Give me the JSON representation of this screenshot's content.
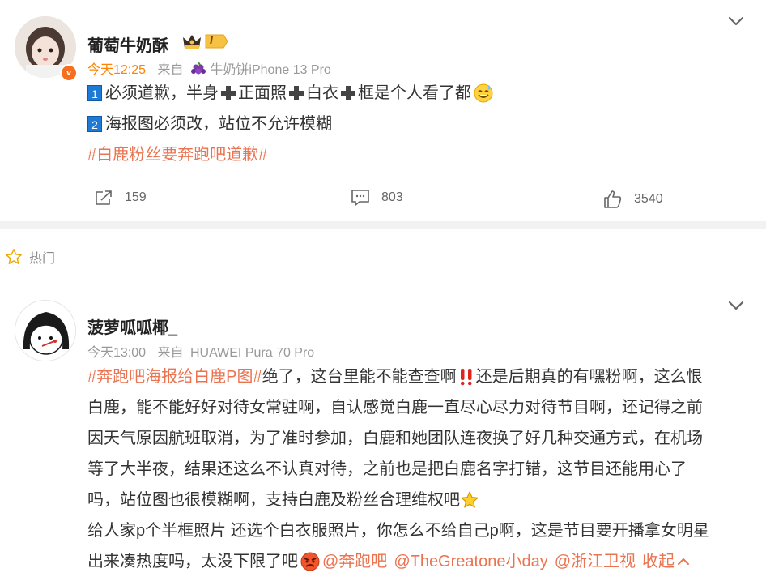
{
  "post1": {
    "username": "葡萄牛奶酥",
    "vip_badge_text": "I",
    "avatar_badge": "v",
    "time": "今天12:25",
    "source_prefix": "来自",
    "source_client": "牛奶饼iPhone 13 Pro",
    "line1_num": "1",
    "line1_a": "必须道歉，半身",
    "line1_b": "正面照",
    "line1_c": "白衣",
    "line1_d": "框是个人看了都",
    "line2_num": "2",
    "line2": "海报图必须改，站位不允许模糊",
    "hashtag": "#白鹿粉丝要奔跑吧道歉#",
    "repost_count": "159",
    "comment_count": "803",
    "like_count": "3540"
  },
  "section": {
    "hot_label": "热门"
  },
  "post2": {
    "username": "菠萝呱呱椰_",
    "time": "今天13:00",
    "source_prefix": "来自",
    "source_client": "HUAWEI Pura 70 Pro",
    "hashtag": "#奔跑吧海报给白鹿P图#",
    "l1_a": "绝了，这台里能不能查查啊",
    "l1_b": "还是后期真的有嘿粉啊，这么恨",
    "l2": "白鹿，能不能好好对待女常驻啊，自认感觉白鹿一直尽心尽力对待节目啊，还记得之前",
    "l3": "因天气原因航班取消，为了准时参加，白鹿和她团队连夜换了好几种交通方式，在机场",
    "l4": "等了大半夜，结果还这么不认真对待，之前也是把白鹿名字打错，这节目还能用心了",
    "l5": "吗，站位图也很模糊啊，支持白鹿及粉丝合理维权吧",
    "l6": "给人家p个半框照片 还选个白衣服照片，你怎么不给自己p啊，这是节目要开播拿女明星",
    "l7_a": "出来凑热度吗，太没下限了吧",
    "mention1": "@奔跑吧",
    "mention2": "@TheGreatone小day",
    "mention3": "@浙江卫视",
    "collapse": "收起"
  },
  "colors": {
    "accent": "#eb7350",
    "hot_time": "#ff8200",
    "meta": "#999999"
  }
}
